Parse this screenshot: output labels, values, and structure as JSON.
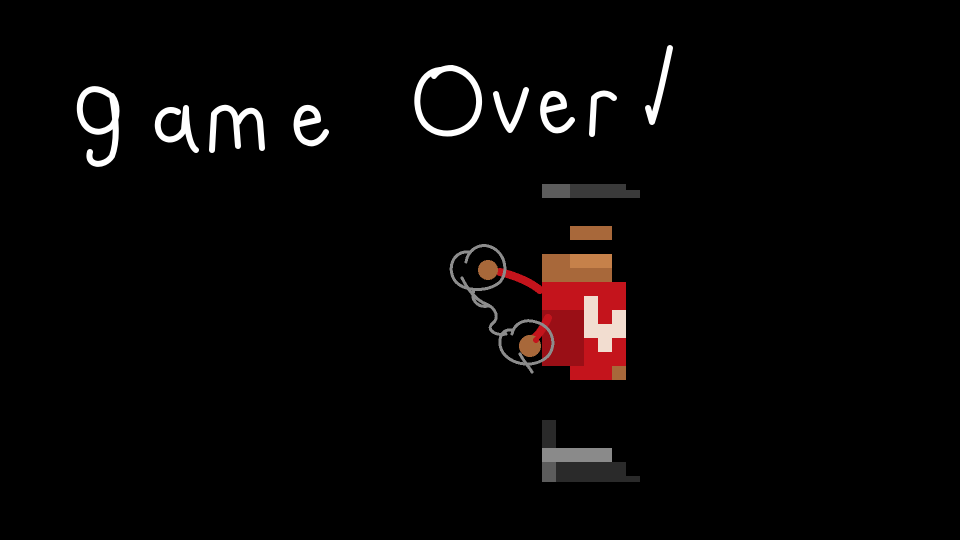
{
  "game": {
    "screen": "game-over",
    "title_text": "game Over!",
    "background_color": "#000000",
    "title_color": "#ffffff"
  },
  "character": {
    "state": "defeated",
    "handcuffed": true,
    "colors": {
      "hat": "#3a3a3a",
      "hat_highlight": "#5c5c5c",
      "skin": "#a8683a",
      "skin_light": "#c6814a",
      "shirt": "#c4141c",
      "shirt_dark": "#9a0f16",
      "shirt_stripe": "#f2ddd0",
      "handcuffs": "#8c8c8c",
      "boots": "#2a2a2a",
      "boots_highlight": "#8a8a8a"
    }
  }
}
